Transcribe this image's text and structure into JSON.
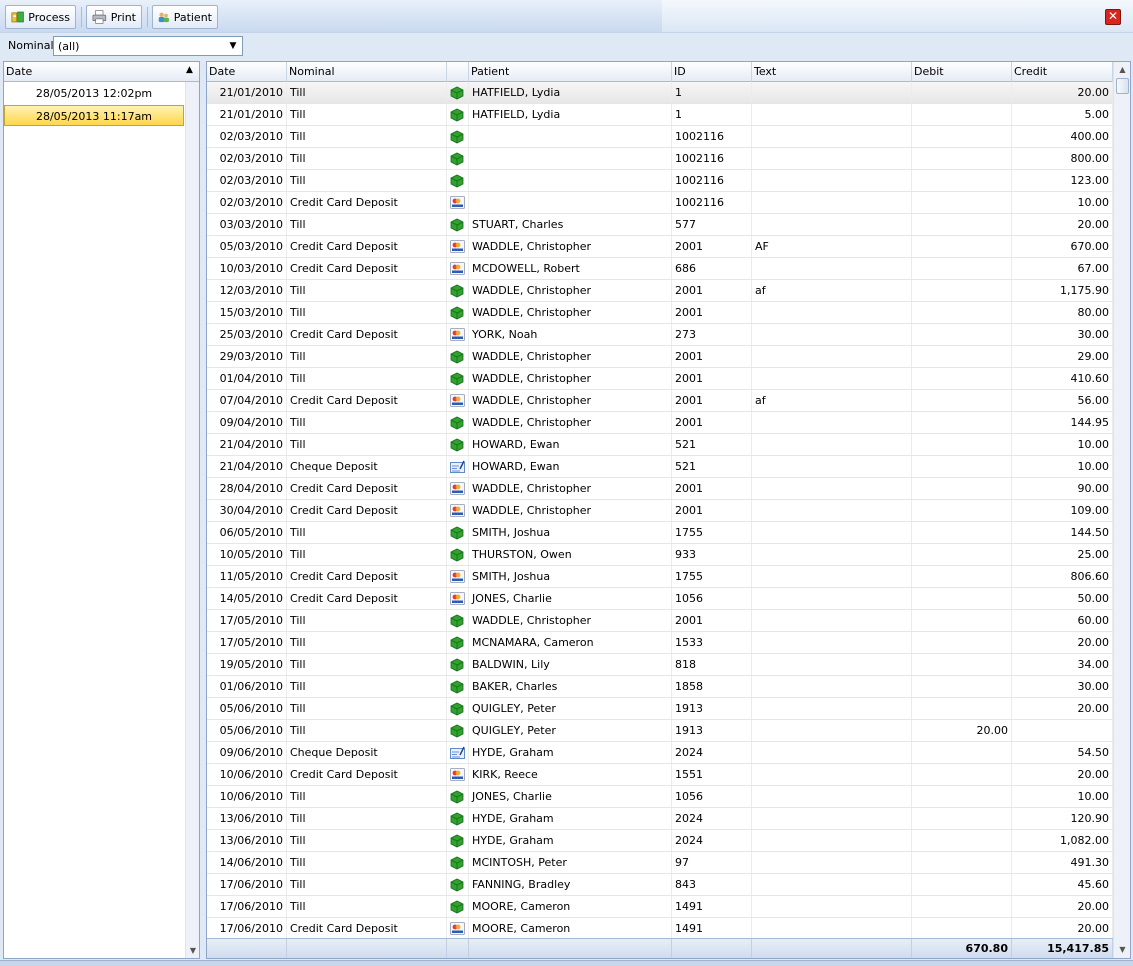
{
  "toolbar": {
    "process_label": "Process",
    "print_label": "Print",
    "patient_label": "Patient",
    "close_glyph": "✕"
  },
  "filter": {
    "label": "Nominal:",
    "selected": "(all)"
  },
  "left_list": {
    "header": "Date",
    "items": [
      {
        "label": "28/05/2013 12:02pm",
        "selected": false
      },
      {
        "label": "28/05/2013 11:17am",
        "selected": true
      }
    ]
  },
  "grid": {
    "columns": {
      "date": "Date",
      "nominal": "Nominal",
      "icon": "",
      "patient": "Patient",
      "id": "ID",
      "text": "Text",
      "debit": "Debit",
      "credit": "Credit"
    },
    "rows": [
      {
        "date": "21/01/2010",
        "nominal": "Till",
        "icon": "till-icon",
        "patient": "HATFIELD, Lydia",
        "id": "1",
        "text": "",
        "debit": "",
        "credit": "20.00"
      },
      {
        "date": "21/01/2010",
        "nominal": "Till",
        "icon": "till-icon",
        "patient": "HATFIELD, Lydia",
        "id": "1",
        "text": "",
        "debit": "",
        "credit": "5.00"
      },
      {
        "date": "02/03/2010",
        "nominal": "Till",
        "icon": "till-icon",
        "patient": "",
        "id": "1002116",
        "text": "",
        "debit": "",
        "credit": "400.00"
      },
      {
        "date": "02/03/2010",
        "nominal": "Till",
        "icon": "till-icon",
        "patient": "",
        "id": "1002116",
        "text": "",
        "debit": "",
        "credit": "800.00"
      },
      {
        "date": "02/03/2010",
        "nominal": "Till",
        "icon": "till-icon",
        "patient": "",
        "id": "1002116",
        "text": "",
        "debit": "",
        "credit": "123.00"
      },
      {
        "date": "02/03/2010",
        "nominal": "Credit Card Deposit",
        "icon": "credit-card-icon",
        "patient": "",
        "id": "1002116",
        "text": "",
        "debit": "",
        "credit": "10.00"
      },
      {
        "date": "03/03/2010",
        "nominal": "Till",
        "icon": "till-icon",
        "patient": "STUART, Charles",
        "id": "577",
        "text": "",
        "debit": "",
        "credit": "20.00"
      },
      {
        "date": "05/03/2010",
        "nominal": "Credit Card Deposit",
        "icon": "credit-card-icon",
        "patient": "WADDLE, Christopher",
        "id": "2001",
        "text": "AF",
        "debit": "",
        "credit": "670.00"
      },
      {
        "date": "10/03/2010",
        "nominal": "Credit Card Deposit",
        "icon": "credit-card-icon",
        "patient": "MCDOWELL, Robert",
        "id": "686",
        "text": "",
        "debit": "",
        "credit": "67.00"
      },
      {
        "date": "12/03/2010",
        "nominal": "Till",
        "icon": "till-icon",
        "patient": "WADDLE, Christopher",
        "id": "2001",
        "text": "af",
        "debit": "",
        "credit": "1,175.90"
      },
      {
        "date": "15/03/2010",
        "nominal": "Till",
        "icon": "till-icon",
        "patient": "WADDLE, Christopher",
        "id": "2001",
        "text": "",
        "debit": "",
        "credit": "80.00"
      },
      {
        "date": "25/03/2010",
        "nominal": "Credit Card Deposit",
        "icon": "credit-card-icon",
        "patient": "YORK, Noah",
        "id": "273",
        "text": "",
        "debit": "",
        "credit": "30.00"
      },
      {
        "date": "29/03/2010",
        "nominal": "Till",
        "icon": "till-icon",
        "patient": "WADDLE, Christopher",
        "id": "2001",
        "text": "",
        "debit": "",
        "credit": "29.00"
      },
      {
        "date": "01/04/2010",
        "nominal": "Till",
        "icon": "till-icon",
        "patient": "WADDLE, Christopher",
        "id": "2001",
        "text": "",
        "debit": "",
        "credit": "410.60"
      },
      {
        "date": "07/04/2010",
        "nominal": "Credit Card Deposit",
        "icon": "credit-card-icon",
        "patient": "WADDLE, Christopher",
        "id": "2001",
        "text": "af",
        "debit": "",
        "credit": "56.00"
      },
      {
        "date": "09/04/2010",
        "nominal": "Till",
        "icon": "till-icon",
        "patient": "WADDLE, Christopher",
        "id": "2001",
        "text": "",
        "debit": "",
        "credit": "144.95"
      },
      {
        "date": "21/04/2010",
        "nominal": "Till",
        "icon": "till-icon",
        "patient": "HOWARD, Ewan",
        "id": "521",
        "text": "",
        "debit": "",
        "credit": "10.00"
      },
      {
        "date": "21/04/2010",
        "nominal": "Cheque Deposit",
        "icon": "cheque-icon",
        "patient": "HOWARD, Ewan",
        "id": "521",
        "text": "",
        "debit": "",
        "credit": "10.00"
      },
      {
        "date": "28/04/2010",
        "nominal": "Credit Card Deposit",
        "icon": "credit-card-icon",
        "patient": "WADDLE, Christopher",
        "id": "2001",
        "text": "",
        "debit": "",
        "credit": "90.00"
      },
      {
        "date": "30/04/2010",
        "nominal": "Credit Card Deposit",
        "icon": "credit-card-icon",
        "patient": "WADDLE, Christopher",
        "id": "2001",
        "text": "",
        "debit": "",
        "credit": "109.00"
      },
      {
        "date": "06/05/2010",
        "nominal": "Till",
        "icon": "till-icon",
        "patient": "SMITH, Joshua",
        "id": "1755",
        "text": "",
        "debit": "",
        "credit": "144.50"
      },
      {
        "date": "10/05/2010",
        "nominal": "Till",
        "icon": "till-icon",
        "patient": "THURSTON, Owen",
        "id": "933",
        "text": "",
        "debit": "",
        "credit": "25.00"
      },
      {
        "date": "11/05/2010",
        "nominal": "Credit Card Deposit",
        "icon": "credit-card-icon",
        "patient": "SMITH, Joshua",
        "id": "1755",
        "text": "",
        "debit": "",
        "credit": "806.60"
      },
      {
        "date": "14/05/2010",
        "nominal": "Credit Card Deposit",
        "icon": "credit-card-icon",
        "patient": "JONES, Charlie",
        "id": "1056",
        "text": "",
        "debit": "",
        "credit": "50.00"
      },
      {
        "date": "17/05/2010",
        "nominal": "Till",
        "icon": "till-icon",
        "patient": "WADDLE, Christopher",
        "id": "2001",
        "text": "",
        "debit": "",
        "credit": "60.00"
      },
      {
        "date": "17/05/2010",
        "nominal": "Till",
        "icon": "till-icon",
        "patient": "MCNAMARA, Cameron",
        "id": "1533",
        "text": "",
        "debit": "",
        "credit": "20.00"
      },
      {
        "date": "19/05/2010",
        "nominal": "Till",
        "icon": "till-icon",
        "patient": "BALDWIN, Lily",
        "id": "818",
        "text": "",
        "debit": "",
        "credit": "34.00"
      },
      {
        "date": "01/06/2010",
        "nominal": "Till",
        "icon": "till-icon",
        "patient": "BAKER, Charles",
        "id": "1858",
        "text": "",
        "debit": "",
        "credit": "30.00"
      },
      {
        "date": "05/06/2010",
        "nominal": "Till",
        "icon": "till-icon",
        "patient": "QUIGLEY, Peter",
        "id": "1913",
        "text": "",
        "debit": "",
        "credit": "20.00"
      },
      {
        "date": "05/06/2010",
        "nominal": "Till",
        "icon": "till-icon",
        "patient": "QUIGLEY, Peter",
        "id": "1913",
        "text": "",
        "debit": "20.00",
        "credit": ""
      },
      {
        "date": "09/06/2010",
        "nominal": "Cheque Deposit",
        "icon": "cheque-icon",
        "patient": "HYDE, Graham",
        "id": "2024",
        "text": "",
        "debit": "",
        "credit": "54.50"
      },
      {
        "date": "10/06/2010",
        "nominal": "Credit Card Deposit",
        "icon": "credit-card-icon",
        "patient": "KIRK, Reece",
        "id": "1551",
        "text": "",
        "debit": "",
        "credit": "20.00"
      },
      {
        "date": "10/06/2010",
        "nominal": "Till",
        "icon": "till-icon",
        "patient": "JONES, Charlie",
        "id": "1056",
        "text": "",
        "debit": "",
        "credit": "10.00"
      },
      {
        "date": "13/06/2010",
        "nominal": "Till",
        "icon": "till-icon",
        "patient": "HYDE, Graham",
        "id": "2024",
        "text": "",
        "debit": "",
        "credit": "120.90"
      },
      {
        "date": "13/06/2010",
        "nominal": "Till",
        "icon": "till-icon",
        "patient": "HYDE, Graham",
        "id": "2024",
        "text": "",
        "debit": "",
        "credit": "1,082.00"
      },
      {
        "date": "14/06/2010",
        "nominal": "Till",
        "icon": "till-icon",
        "patient": "MCINTOSH, Peter",
        "id": "97",
        "text": "",
        "debit": "",
        "credit": "491.30"
      },
      {
        "date": "17/06/2010",
        "nominal": "Till",
        "icon": "till-icon",
        "patient": "FANNING, Bradley",
        "id": "843",
        "text": "",
        "debit": "",
        "credit": "45.60"
      },
      {
        "date": "17/06/2010",
        "nominal": "Till",
        "icon": "till-icon",
        "patient": "MOORE, Cameron",
        "id": "1491",
        "text": "",
        "debit": "",
        "credit": "20.00"
      },
      {
        "date": "17/06/2010",
        "nominal": "Credit Card Deposit",
        "icon": "credit-card-icon",
        "patient": "MOORE, Cameron",
        "id": "1491",
        "text": "",
        "debit": "",
        "credit": "20.00"
      }
    ],
    "totals": {
      "debit": "670.80",
      "credit": "15,417.85"
    }
  },
  "colors": {
    "selection": "#ffd74d",
    "till_green": "#2fa22f",
    "toolbar": "#dbe6f5"
  }
}
